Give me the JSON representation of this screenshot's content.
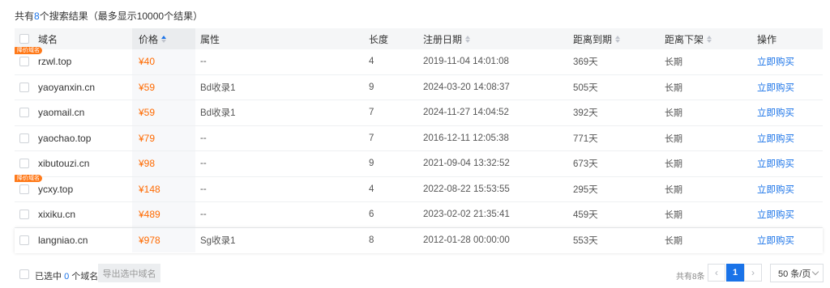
{
  "summary": {
    "prefix": "共有",
    "count": "8",
    "suffix": "个搜索结果（最多显示10000个结果）"
  },
  "columns": {
    "domain": "域名",
    "price": "价格",
    "attr": "属性",
    "length": "长度",
    "reg_date": "注册日期",
    "expire": "距离到期",
    "delist": "距离下架",
    "op": "操作"
  },
  "tag_label": "降价域名",
  "rows": [
    {
      "domain": "rzwl.top",
      "price": "¥40",
      "attr": "--",
      "length": "4",
      "reg_date": "2019-11-04 14:01:08",
      "expire": "369天",
      "delist": "长期",
      "action": "立即购买",
      "tag": true
    },
    {
      "domain": "yaoyanxin.cn",
      "price": "¥59",
      "attr": "Bd收录1",
      "length": "9",
      "reg_date": "2024-03-20 14:08:37",
      "expire": "505天",
      "delist": "长期",
      "action": "立即购买",
      "tag": false
    },
    {
      "domain": "yaomail.cn",
      "price": "¥59",
      "attr": "Bd收录1",
      "length": "7",
      "reg_date": "2024-11-27 14:04:52",
      "expire": "392天",
      "delist": "长期",
      "action": "立即购买",
      "tag": false
    },
    {
      "domain": "yaochao.top",
      "price": "¥79",
      "attr": "--",
      "length": "7",
      "reg_date": "2016-12-11 12:05:38",
      "expire": "771天",
      "delist": "长期",
      "action": "立即购买",
      "tag": false
    },
    {
      "domain": "xibutouzi.cn",
      "price": "¥98",
      "attr": "--",
      "length": "9",
      "reg_date": "2021-09-04 13:32:52",
      "expire": "673天",
      "delist": "长期",
      "action": "立即购买",
      "tag": false
    },
    {
      "domain": "ycxy.top",
      "price": "¥148",
      "attr": "--",
      "length": "4",
      "reg_date": "2022-08-22 15:53:55",
      "expire": "295天",
      "delist": "长期",
      "action": "立即购买",
      "tag": true
    },
    {
      "domain": "xixiku.cn",
      "price": "¥489",
      "attr": "--",
      "length": "6",
      "reg_date": "2023-02-02 21:35:41",
      "expire": "459天",
      "delist": "长期",
      "action": "立即购买",
      "tag": false
    },
    {
      "domain": "langniao.cn",
      "price": "¥978",
      "attr": "Sg收录1",
      "length": "8",
      "reg_date": "2012-01-28 00:00:00",
      "expire": "553天",
      "delist": "长期",
      "action": "立即购买",
      "tag": false,
      "hovered": true
    }
  ],
  "footer": {
    "selected_prefix": "已选中",
    "selected_count": "0",
    "selected_suffix": "个域名",
    "export_label": "导出选中域名",
    "total_text": "共有8条",
    "current_page": "1",
    "prev_icon": "‹",
    "next_icon": "›",
    "page_size": "50 条/页"
  }
}
